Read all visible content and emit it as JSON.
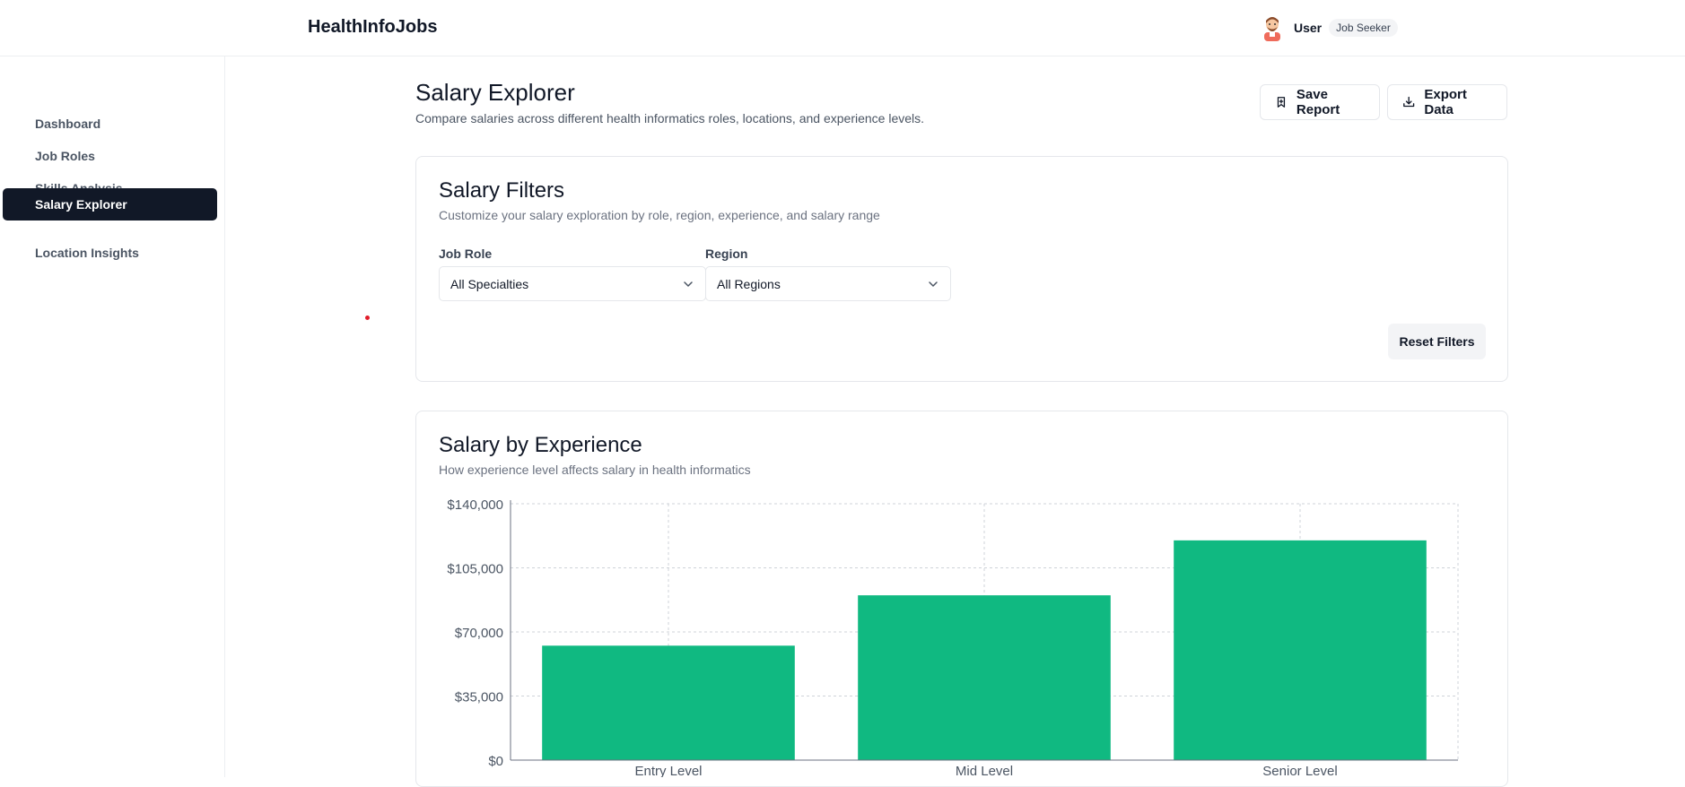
{
  "header": {
    "logo": "HealthInfoJobs",
    "user_name": "User",
    "user_role": "Job Seeker"
  },
  "sidebar": {
    "items": [
      {
        "label": "Dashboard",
        "active": false
      },
      {
        "label": "Job Roles",
        "active": false
      },
      {
        "label": "Skills Analysis",
        "active": false
      },
      {
        "label": "Salary Explorer",
        "active": true
      },
      {
        "label": "Location Insights",
        "active": false
      }
    ]
  },
  "page": {
    "title": "Salary Explorer",
    "subtitle": "Compare salaries across different health informatics roles, locations, and experience levels.",
    "save_label": "Save Report",
    "export_label": "Export Data"
  },
  "filters": {
    "title": "Salary Filters",
    "description": "Customize your salary exploration by role, region, experience, and salary range",
    "job_role_label": "Job Role",
    "job_role_value": "All Specialties",
    "region_label": "Region",
    "region_value": "All Regions",
    "reset_label": "Reset Filters"
  },
  "chart_card": {
    "title": "Salary by Experience",
    "description": "How experience level affects salary in health informatics"
  },
  "chart_data": {
    "type": "bar",
    "categories": [
      "Entry Level",
      "Mid Level",
      "Senior Level"
    ],
    "values": [
      62500,
      90000,
      120000
    ],
    "y_ticks": [
      "$0",
      "$35,000",
      "$70,000",
      "$105,000",
      "$140,000"
    ],
    "ylim": [
      0,
      140000
    ],
    "grid": true,
    "bar_color": "#10b981"
  },
  "colors": {
    "accent": "#111827",
    "bar": "#10b981",
    "cursor": "#e11d2a"
  }
}
